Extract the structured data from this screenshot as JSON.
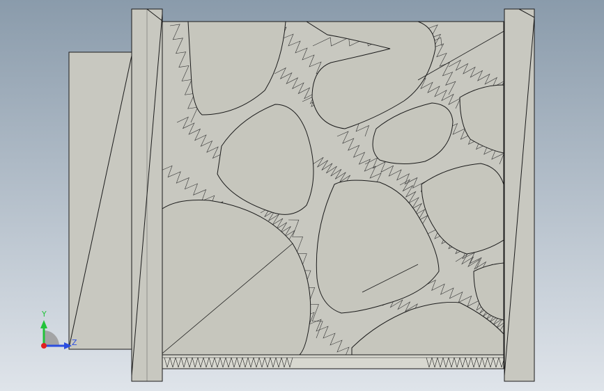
{
  "viewport": {
    "background_top": "#8a9bab",
    "background_bottom": "#dfe4ea",
    "part_fill": "#c8c8c0",
    "part_edge": "#1a1a1a",
    "mesh_line": "#222222"
  },
  "triad": {
    "y_label": "Y",
    "z_label": "Z",
    "y_color": "#22c33a",
    "z_color": "#2a4de0",
    "x_color": "#e02020"
  }
}
